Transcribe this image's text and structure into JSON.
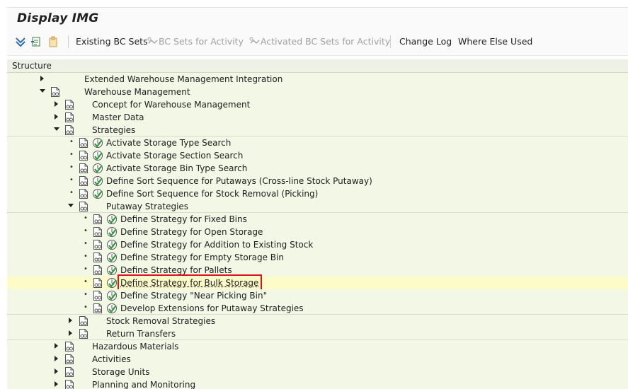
{
  "window": {
    "title": "Display IMG"
  },
  "toolbar": {
    "existing_bc_sets": "Existing BC Sets",
    "bc_sets_for_activity": "BC Sets for Activity",
    "activated_bc_sets": "Activated BC Sets for Activity",
    "change_log": "Change Log",
    "where_else_used": "Where Else Used"
  },
  "tree": {
    "header": "Structure",
    "rows": [
      {
        "label": "Extended Warehouse Management Integration",
        "level": 0,
        "expander": "collapsed",
        "has_doc": false,
        "has_activity": false
      },
      {
        "label": "Warehouse Management",
        "level": 0,
        "expander": "expanded",
        "has_doc": true,
        "has_activity": false
      },
      {
        "label": "Concept for Warehouse Management",
        "level": 1,
        "expander": "collapsed",
        "has_doc": true,
        "has_activity": false
      },
      {
        "label": "Master Data",
        "level": 1,
        "expander": "collapsed",
        "has_doc": true,
        "has_activity": false
      },
      {
        "label": "Strategies",
        "level": 1,
        "expander": "expanded",
        "has_doc": true,
        "has_activity": false
      },
      {
        "label": "Activate Storage Type Search",
        "level": 2,
        "expander": "leaf",
        "has_doc": true,
        "has_activity": true
      },
      {
        "label": "Activate Storage Section Search",
        "level": 2,
        "expander": "leaf",
        "has_doc": true,
        "has_activity": true
      },
      {
        "label": "Activate Storage Bin Type Search",
        "level": 2,
        "expander": "leaf",
        "has_doc": true,
        "has_activity": true
      },
      {
        "label": "Define Sort Sequence for Putaways (Cross-line Stock Putaway)",
        "level": 2,
        "expander": "leaf",
        "has_doc": true,
        "has_activity": true
      },
      {
        "label": "Define Sort Sequence for Stock Removal (Picking)",
        "level": 2,
        "expander": "leaf",
        "has_doc": true,
        "has_activity": true
      },
      {
        "label": "Putaway Strategies",
        "level": 2,
        "expander": "expanded",
        "has_doc": true,
        "has_activity": false
      },
      {
        "label": "Define Strategy for Fixed Bins",
        "level": 3,
        "expander": "leaf",
        "has_doc": true,
        "has_activity": true
      },
      {
        "label": "Define Strategy for Open Storage",
        "level": 3,
        "expander": "leaf",
        "has_doc": true,
        "has_activity": true
      },
      {
        "label": "Define Strategy for Addition to Existing Stock",
        "level": 3,
        "expander": "leaf",
        "has_doc": true,
        "has_activity": true
      },
      {
        "label": "Define Strategy for Empty Storage Bin",
        "level": 3,
        "expander": "leaf",
        "has_doc": true,
        "has_activity": true
      },
      {
        "label": "Define Strategy for Pallets",
        "level": 3,
        "expander": "leaf",
        "has_doc": true,
        "has_activity": true
      },
      {
        "label": "Define Strategy for Bulk Storage",
        "level": 3,
        "expander": "leaf",
        "has_doc": true,
        "has_activity": true,
        "selected": true
      },
      {
        "label": "Define Strategy \"Near Picking Bin\"",
        "level": 3,
        "expander": "leaf",
        "has_doc": true,
        "has_activity": true
      },
      {
        "label": "Develop Extensions for Putaway Strategies",
        "level": 3,
        "expander": "leaf",
        "has_doc": true,
        "has_activity": true
      },
      {
        "label": "Stock Removal Strategies",
        "level": 2,
        "expander": "collapsed",
        "has_doc": true,
        "has_activity": false
      },
      {
        "label": "Return Transfers",
        "level": 2,
        "expander": "collapsed",
        "has_doc": true,
        "has_activity": false
      },
      {
        "label": "Hazardous Materials",
        "level": 1,
        "expander": "collapsed",
        "has_doc": true,
        "has_activity": false
      },
      {
        "label": "Activities",
        "level": 1,
        "expander": "collapsed",
        "has_doc": true,
        "has_activity": false
      },
      {
        "label": "Storage Units",
        "level": 1,
        "expander": "collapsed",
        "has_doc": true,
        "has_activity": false
      },
      {
        "label": "Planning and Monitoring",
        "level": 1,
        "expander": "collapsed",
        "has_doc": true,
        "has_activity": false
      }
    ]
  },
  "colors": {
    "highlight_border": "#d9141a",
    "selected_row": "#fdfcc8",
    "row_tint": "#f3f7e6",
    "activity_green": "#2e9a3a"
  },
  "icons": {
    "doc": "documentation-icon",
    "activity": "execute-activity-icon",
    "expand": "triangle-right-icon",
    "collapse": "triangle-down-icon"
  }
}
